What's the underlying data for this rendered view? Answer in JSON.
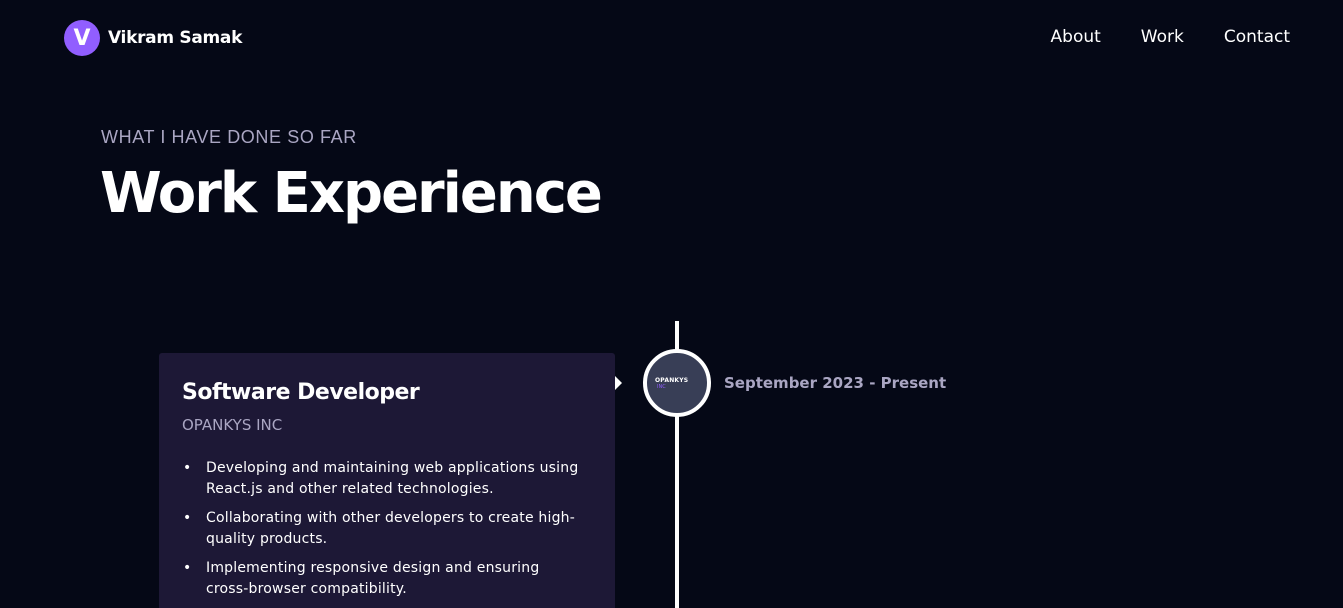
{
  "brand": {
    "logo_letter": "V",
    "name": "Vikram Samak"
  },
  "nav": {
    "items": [
      "About",
      "Work",
      "Contact"
    ]
  },
  "section": {
    "subtitle": "WHAT I HAVE DONE SO FAR",
    "title": "Work Experience"
  },
  "experience": {
    "title": "Software Developer",
    "company": "OPANKYS INC",
    "company_logo": {
      "line1": "OPANKYS",
      "line2": "INC"
    },
    "date": "September 2023 - Present",
    "points": [
      "Developing and maintaining web applications using React.js and other related technologies.",
      "Collaborating with other developers to create high-quality products.",
      "Implementing responsive design and ensuring cross-browser compatibility."
    ],
    "card_color": "#1d1836",
    "icon_bg": "#383e56"
  },
  "colors": {
    "background": "#050816",
    "accent": "#915eff",
    "secondary_text": "#aaa6c3"
  }
}
